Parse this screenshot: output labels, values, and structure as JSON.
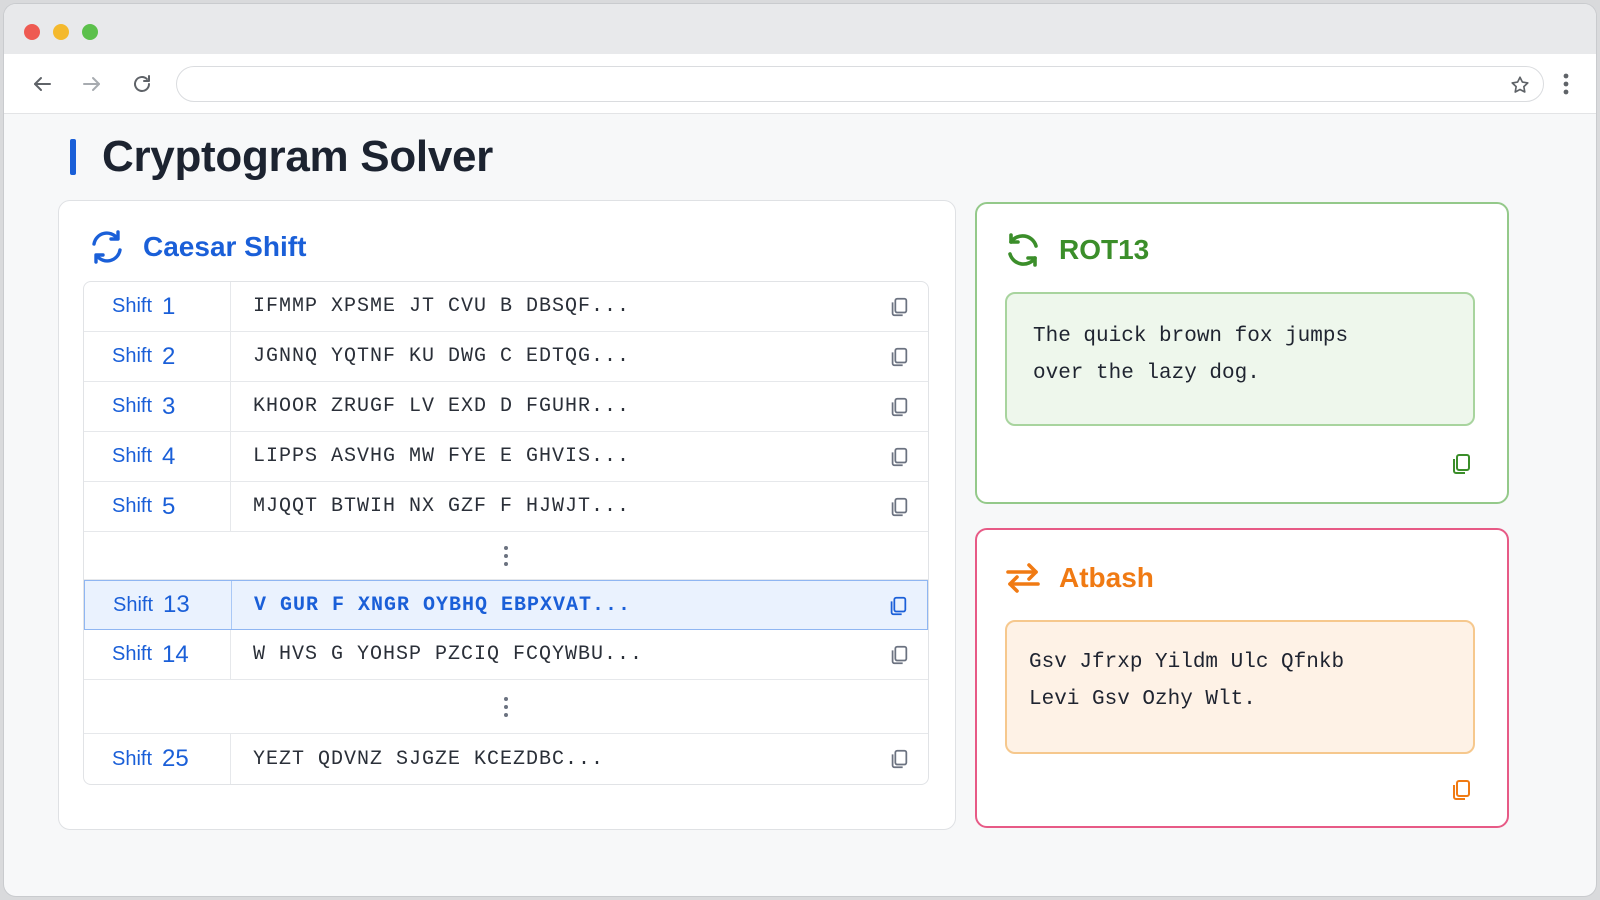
{
  "browser": {
    "url": "",
    "url_placeholder": ""
  },
  "page": {
    "title": "Cryptogram Solver"
  },
  "caesar": {
    "title": "Caesar Shift",
    "shift_word": "Shift",
    "rows": [
      {
        "shift": "1",
        "text": "IFMMP XPSME JT CVU B DBSQF..."
      },
      {
        "shift": "2",
        "text": "JGNNQ YQTNF KU DWG C EDTQG..."
      },
      {
        "shift": "3",
        "text": "KHOOR ZRUGF LV EXD D FGUHR..."
      },
      {
        "shift": "4",
        "text": "LIPPS ASVHG MW FYE E GHVIS..."
      },
      {
        "shift": "5",
        "text": "MJQQT BTWIH NX GZF F HJWJT..."
      },
      {
        "shift": "13",
        "text": "V GUR F XNGR OYBHQ EBPXVAT..."
      },
      {
        "shift": "14",
        "text": "W HVS G YOHSP PZCIQ FCQYWBU..."
      },
      {
        "shift": "25",
        "text": "YEZT QDVNZ SJGZE KCEZDBC..."
      }
    ]
  },
  "rot13": {
    "title": "ROT13",
    "line1": "The quick brown fox jumps",
    "line2": "over the lazy dog."
  },
  "atbash": {
    "title": "Atbash",
    "line1": "Gsv Jfrxp Yildm Ulc Qfnkb",
    "line2": "Levi Gsv Ozhy Wlt."
  },
  "colors": {
    "caesar_accent": "#1a5fd8",
    "rot13_accent": "#3b8e2a",
    "atbash_accent": "#f07a13",
    "atbash_border": "#e75a86"
  },
  "icons": {
    "back": "arrow-left-icon",
    "forward": "arrow-right-icon",
    "reload": "reload-icon",
    "bookmark": "star-icon",
    "menu": "kebab-menu-icon",
    "caesar": "sync-arrows-icon",
    "rot13": "refresh-icon",
    "atbash": "swap-arrows-icon",
    "copy": "copy-icon"
  }
}
